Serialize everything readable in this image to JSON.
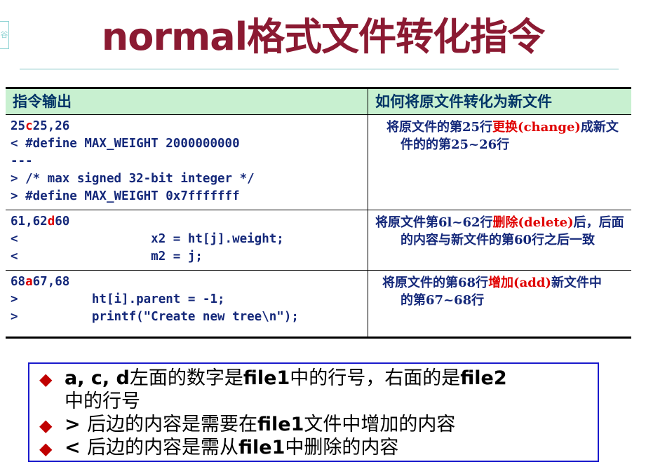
{
  "corner_glyph": "谷",
  "title": "normal格式文件转化指令",
  "table": {
    "headers": [
      "指令输出",
      "如何将原文件转化为新文件"
    ],
    "rows": [
      {
        "code_prefix": "25",
        "code_cmd": "c",
        "code_suffix": "25,26",
        "code_lines": [
          "< #define MAX_WEIGHT 2000000000",
          "---",
          "> /* max signed 32-bit integer */",
          "> #define MAX_WEIGHT 0x7fffffff"
        ],
        "desc_pre": "将原文件的第25行",
        "desc_hl": "更换(change)",
        "desc_post": "成新文",
        "desc_line2": "件的的第25~26行"
      },
      {
        "code_prefix": "61,62",
        "code_cmd": "d",
        "code_suffix": "60",
        "code_lines": [
          "<                  x2 = ht[j].weight;",
          "<                  m2 = j;"
        ],
        "desc_pre": "将原文件第6l~62行",
        "desc_hl": "删除(delete)",
        "desc_post": "后，后面",
        "desc_line2": "的内容与新文件的第60行之后一致"
      },
      {
        "code_prefix": "68",
        "code_cmd": "a",
        "code_suffix": "67,68",
        "code_lines": [
          ">          ht[i].parent = -1;",
          ">          printf(\"Create new tree\\n\");"
        ],
        "desc_pre": "将原文件的第68行",
        "desc_hl": "增加(add)",
        "desc_post": "新文件中",
        "desc_line2": "的第67~68行"
      }
    ]
  },
  "notes": [
    {
      "bold": "a, c, d",
      "text": "左面的数字是",
      "bold2": "file1",
      "text2": "中的行号，右面的是",
      "bold3": "file2",
      "text3": "中的行号"
    },
    {
      "bold": "> ",
      "text": "后边的内容是需要在",
      "bold2": "file1",
      "text2": "文件中增加的内容"
    },
    {
      "bold": "< ",
      "text": "后边的内容是需从",
      "bold2": "file1",
      "text2": "中删除的内容"
    }
  ],
  "colors": {
    "title": "#8b1a32",
    "header_bg": "#c8f0d0",
    "text_blue": "#14287a",
    "highlight_red": "#e00000",
    "notes_border": "#1a1acc",
    "bullet": "#c00000"
  },
  "icons": {
    "bullet": "diamond-icon"
  }
}
